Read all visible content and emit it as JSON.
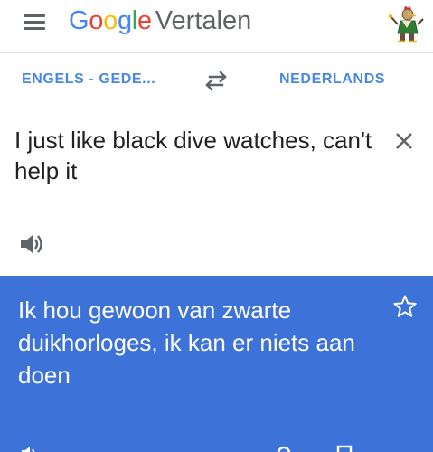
{
  "header": {
    "logo_letters": [
      {
        "char": "G",
        "color": "#4285F4"
      },
      {
        "char": "o",
        "color": "#EA4335"
      },
      {
        "char": "o",
        "color": "#FBBC05"
      },
      {
        "char": "g",
        "color": "#4285F4"
      },
      {
        "char": "l",
        "color": "#34A853"
      },
      {
        "char": "e",
        "color": "#EA4335"
      }
    ],
    "product_name": "Vertalen",
    "menu_icon": "hamburger-menu-icon",
    "avatar_icon": "profile-avatar-cartoon-rooster"
  },
  "language_bar": {
    "source_language": "ENGELS - GEDE...",
    "target_language": "NEDERLANDS",
    "swap_icon": "swap-arrows-icon",
    "accent_color": "#4A86E8"
  },
  "input": {
    "text": "I just like black dive watches, can't help it",
    "clear_icon": "close-icon",
    "listen_icon": "speaker-icon"
  },
  "result": {
    "text": "Ik hou gewoon van zwarte duikhorloges, ik kan er niets aan doen",
    "background_color": "#3D72D8",
    "star_icon": "star-outline-icon",
    "bottom_icons": [
      "speaker-icon",
      "search-icon",
      "copy-icon"
    ]
  }
}
